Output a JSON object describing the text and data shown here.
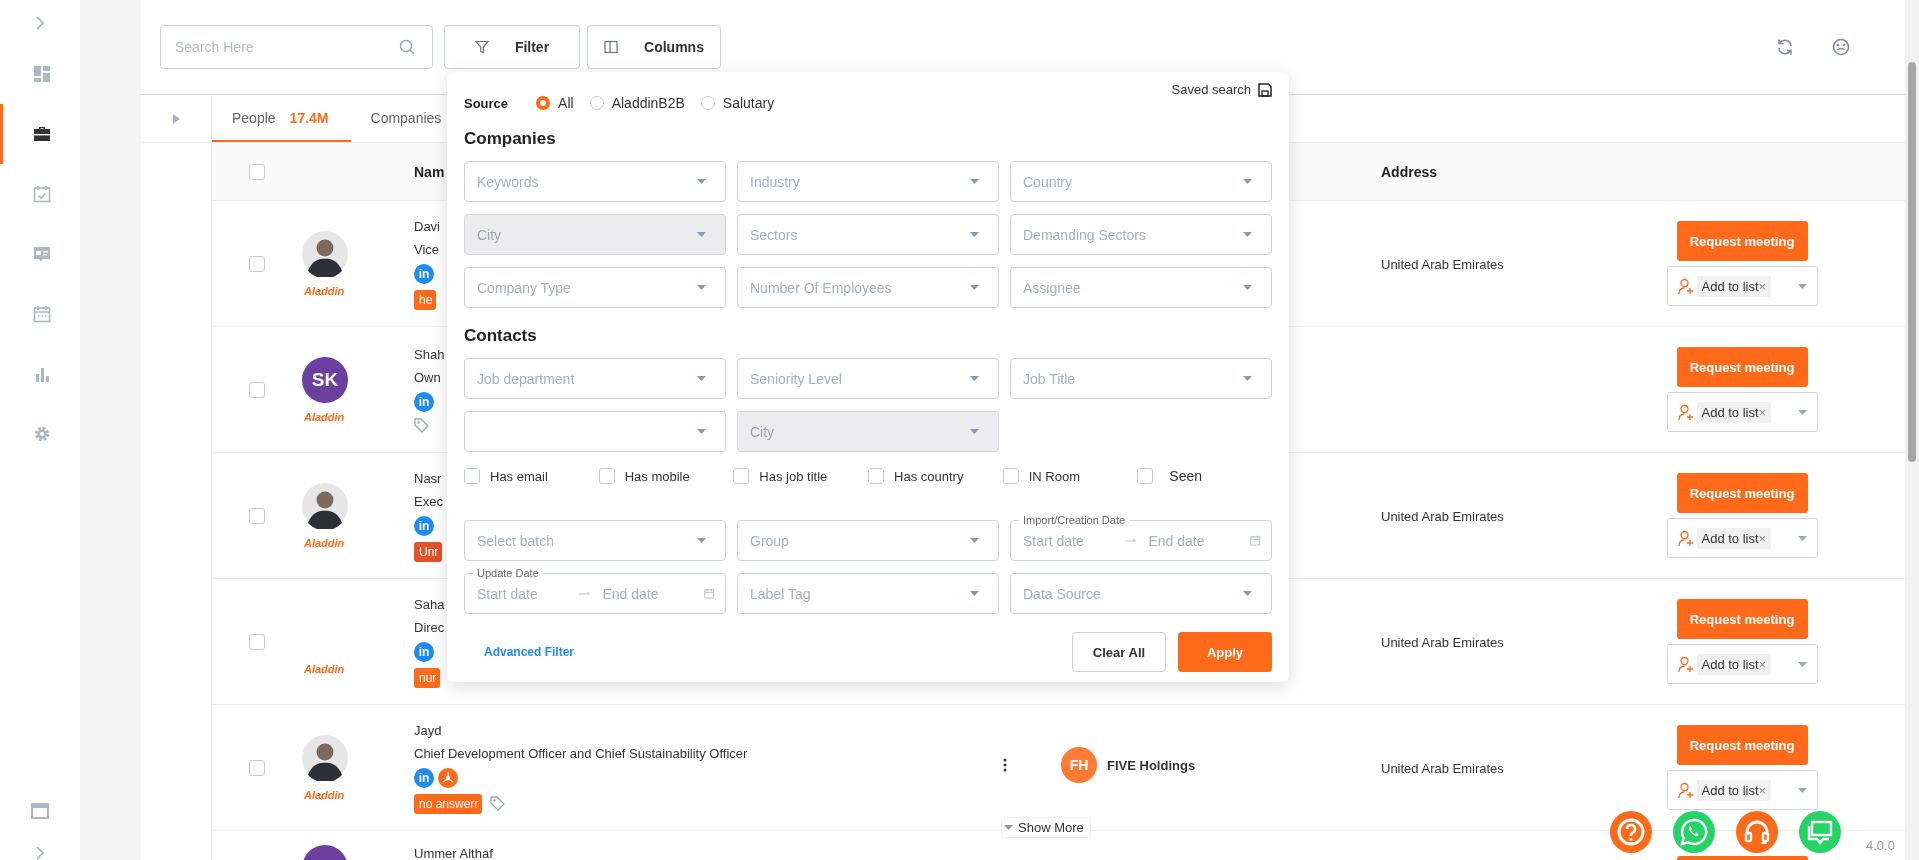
{
  "sidebar": {
    "items": [
      {
        "selected": false
      },
      {
        "selected": true
      },
      {
        "selected": false
      },
      {
        "selected": false
      },
      {
        "selected": false
      },
      {
        "selected": false
      },
      {
        "selected": false
      }
    ]
  },
  "toolbar": {
    "search": {
      "placeholder": "Search Here"
    },
    "buttons": [
      "Filter",
      "Columns"
    ]
  },
  "tabs": [
    {
      "label": "People",
      "count": "17.4M",
      "selected": true
    },
    {
      "label": "Companies",
      "selected": false
    }
  ],
  "table": {
    "select_all": {
      "checked": false
    },
    "columns": [
      "Nam",
      "Address"
    ],
    "rows": [
      {
        "kind": "full",
        "checked": false,
        "avatar": {
          "kind": "photo"
        },
        "source": "Aladdin",
        "name": "Davi",
        "title": "Vice",
        "linkedin": "in",
        "extra_icon": false,
        "tags": [
          {
            "label": "he",
            "color": "#ff6a1a"
          }
        ],
        "tag_icon": false,
        "address": "United Arab Emirates",
        "request": "Request meeting",
        "list": "Add to list",
        "list_remove": "×"
      },
      {
        "kind": "full",
        "checked": false,
        "avatar": {
          "kind": "initials",
          "initials": "SK"
        },
        "source": "Aladdin",
        "name": "Shah",
        "title": "Own",
        "linkedin": "in",
        "extra_icon": false,
        "tags": [],
        "tag_icon": true,
        "request": "Request meeting",
        "list": "Add to list",
        "list_remove": "×"
      },
      {
        "kind": "full",
        "checked": false,
        "avatar": {
          "kind": "photo"
        },
        "source": "Aladdin",
        "name": "Nasr",
        "title": "Exec",
        "linkedin": "in",
        "extra_icon": false,
        "tags": [
          {
            "label": "Unr",
            "color": "#e2522b"
          }
        ],
        "tag_icon": false,
        "address": "United Arab Emirates",
        "request": "Request meeting",
        "list": "Add to list",
        "list_remove": "×"
      },
      {
        "kind": "full",
        "checked": false,
        "avatar": {
          "kind": "none"
        },
        "source": "Aladdin",
        "name": "Saha",
        "title": "Direc",
        "linkedin": "in",
        "extra_icon": false,
        "tags": [
          {
            "label": "nur",
            "color": "#ff6a1a"
          }
        ],
        "tag_icon": false,
        "address": "United Arab Emirates",
        "request": "Request meeting",
        "list": "Add to list",
        "list_remove": "×"
      },
      {
        "kind": "full",
        "checked": false,
        "avatar": {
          "kind": "photo"
        },
        "source": "Aladdin",
        "name": "Jayd",
        "title": "Chief Development Officer and Chief Sustainability Officer",
        "linkedin": "in",
        "extra_icon": true,
        "tags": [
          {
            "label": "no answerr",
            "color": "#ff6a1a"
          }
        ],
        "tag_icon": true,
        "company": {
          "initials": "FH",
          "name": "FIVE Holdings"
        },
        "show_more": "Show More",
        "address": "United Arab Emirates",
        "request": "Request meeting",
        "list": "Add to list",
        "list_remove": "×"
      },
      {
        "kind": "partial",
        "avatar": {
          "kind": "plain"
        },
        "name": "Ummer Althaf"
      }
    ]
  },
  "filter_panel": {
    "saved_search": "Saved search",
    "source": {
      "label": "Source",
      "options": [
        {
          "label": "All",
          "selected": true
        },
        {
          "label": "AladdinB2B",
          "selected": false
        },
        {
          "label": "Salutary",
          "selected": false
        }
      ]
    },
    "sections": [
      {
        "title": "Companies",
        "fields": [
          {
            "placeholder": "Keywords",
            "disabled": false
          },
          {
            "placeholder": "Industry",
            "disabled": false
          },
          {
            "placeholder": "Country",
            "disabled": false
          },
          {
            "placeholder": "City",
            "disabled": true
          },
          {
            "placeholder": "Sectors",
            "disabled": false
          },
          {
            "placeholder": "Demanding Sectors",
            "disabled": false
          },
          {
            "placeholder": "Company Type",
            "disabled": false
          },
          {
            "placeholder": "Number Of Employees",
            "disabled": false
          },
          {
            "placeholder": "Assignee",
            "disabled": false
          }
        ]
      },
      {
        "title": "Contacts",
        "fields": [
          {
            "placeholder": "Job department",
            "disabled": false
          },
          {
            "placeholder": "Seniority Level",
            "disabled": false
          },
          {
            "placeholder": "Job Title",
            "disabled": false
          },
          {
            "disabled": false
          },
          {
            "placeholder": "City",
            "disabled": true
          }
        ]
      }
    ],
    "checkboxes": [
      {
        "label": "Has email",
        "checked": false
      },
      {
        "label": "Has mobile",
        "checked": false
      },
      {
        "label": "Has job title",
        "checked": false
      },
      {
        "label": "Has country",
        "checked": false
      },
      {
        "label": "IN Room",
        "checked": false
      },
      {
        "label": "Seen",
        "checked": false
      }
    ],
    "more_fields": [
      {
        "kind": "select",
        "placeholder": "Select batch"
      },
      {
        "kind": "select",
        "placeholder": "Group"
      },
      {
        "kind": "date_range",
        "legend": "Import/Creation Date",
        "start": {
          "placeholder": "Start date"
        },
        "end": {
          "placeholder": "End date"
        }
      },
      {
        "kind": "date_range",
        "legend": "Update Date",
        "start": {
          "placeholder": "Start date"
        },
        "end": {
          "placeholder": "End date"
        }
      },
      {
        "kind": "select",
        "placeholder": "Label Tag"
      },
      {
        "kind": "select",
        "placeholder": "Data Source"
      }
    ],
    "advanced": "Advanced Filter",
    "clear": "Clear All",
    "apply": "Apply"
  },
  "floating_buttons": [
    {
      "kind": "help",
      "color": "#ff6a1a"
    },
    {
      "kind": "whatsapp",
      "color": "#25d366"
    },
    {
      "kind": "support",
      "color": "#ff6a1a"
    },
    {
      "kind": "chat",
      "color": "#25d366"
    }
  ],
  "version": "4.0.0"
}
